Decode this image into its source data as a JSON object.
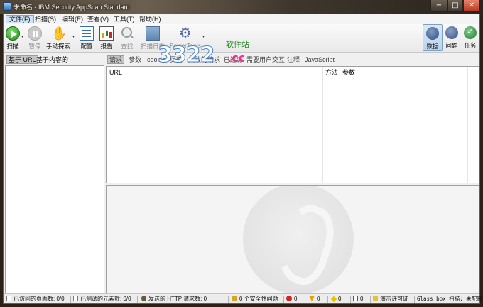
{
  "window": {
    "title": "未命名 - IBM Security AppScan Standard",
    "minimize_glyph": "−",
    "maximize_glyph": "□",
    "close_glyph": "✕"
  },
  "menu": [
    "文件(F)",
    "扫描(S)",
    "编辑(E)",
    "查看(V)",
    "工具(T)",
    "帮助(H)"
  ],
  "toolbar": {
    "scan": "扫描",
    "pause": "暂停",
    "manual_explore": "手动探索",
    "config": "配置",
    "report": "报告",
    "find": "查找",
    "scan_log": "扫描日志",
    "power_tools": "PowerTools",
    "dropdown_glyph": "▾"
  },
  "views": {
    "data": "数据",
    "issues": "问题",
    "tasks": "任务"
  },
  "left_tabs": [
    "基于 URL",
    "基于内容的"
  ],
  "right_tabs": [
    "请求",
    "参数",
    "cookie",
    "页面",
    "失败的请求",
    "已过滤",
    "需要用户交互",
    "注释",
    "JavaScript"
  ],
  "grid_columns": [
    "URL",
    "方法",
    "参数"
  ],
  "status": {
    "visited_pages": "已访问的页面数: 0/0",
    "tested_elements": "已测试的元素数: 0/0",
    "http_requests": "发送的 HTTP 请求数: 0",
    "security_issues": "0 个安全性问题",
    "high": "0",
    "medium": "0",
    "low": "0",
    "info": "0",
    "license": "演示许可证",
    "glass_box": "Glass box 扫描: 未配置"
  },
  "site_watermark": {
    "big": "3322",
    "cc": ".cc",
    "small": "软件站"
  },
  "colors": {
    "accent": "#3a6ea5",
    "title_bar": "#4d4437",
    "panel": "#f0f0f0"
  }
}
